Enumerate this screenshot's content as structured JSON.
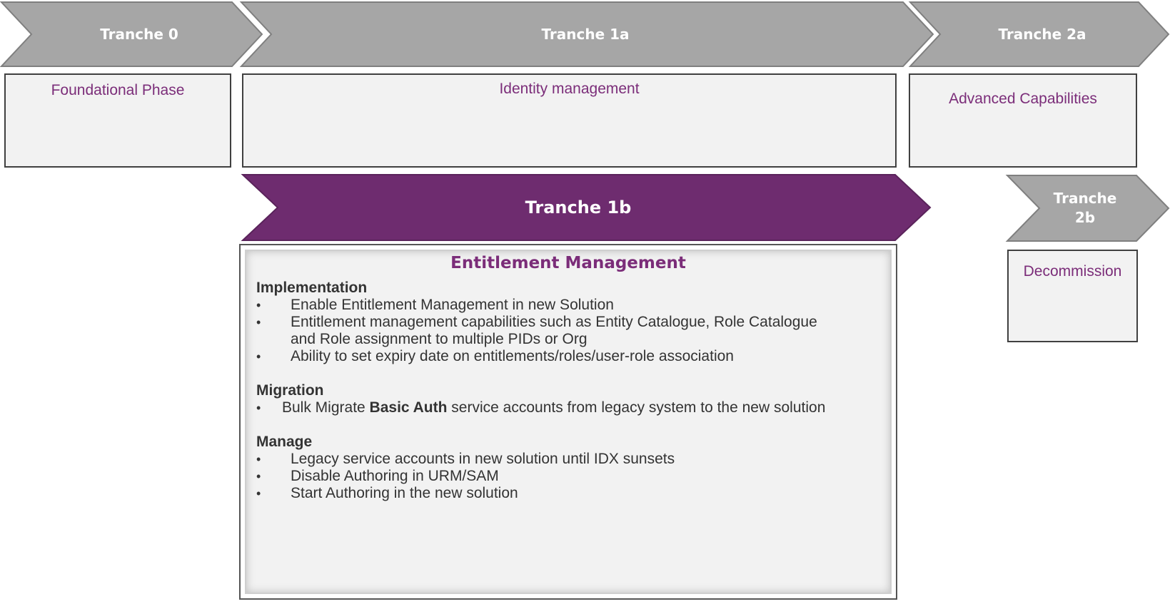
{
  "colors": {
    "grey_chevron": "#a6a6a6",
    "purple_chevron": "#6e2c6f",
    "phase_text": "#7b2d79",
    "box_fill": "#f2f2f2",
    "box_border": "#404040"
  },
  "tranches": {
    "t0": {
      "label": "Tranche 0",
      "phase": "Foundational Phase"
    },
    "t1a": {
      "label": "Tranche 1a",
      "phase": "Identity management"
    },
    "t2a": {
      "label": "Tranche 2a",
      "phase": "Advanced Capabilities"
    },
    "t1b": {
      "label": "Tranche 1b"
    },
    "t2b": {
      "label_line1": "Tranche",
      "label_line2": "2b",
      "phase": "Decommission"
    }
  },
  "entitlement": {
    "title": "Entitlement Management",
    "implementation": {
      "heading": "Implementation",
      "items": [
        "Enable Entitlement Management in new Solution",
        "Entitlement management capabilities such as Entity Catalogue, Role Catalogue and Role assignment to multiple PIDs or Org",
        "Ability to set expiry date on entitlements/roles/user-role association"
      ]
    },
    "migration": {
      "heading": "Migration",
      "item_prefix": "Bulk Migrate ",
      "item_bold": "Basic Auth",
      "item_suffix": " service accounts from legacy system to the new solution"
    },
    "manage": {
      "heading": "Manage",
      "items": [
        "Legacy service accounts in new solution until IDX sunsets",
        "Disable Authoring in URM/SAM",
        "Start Authoring in the new solution"
      ]
    }
  }
}
